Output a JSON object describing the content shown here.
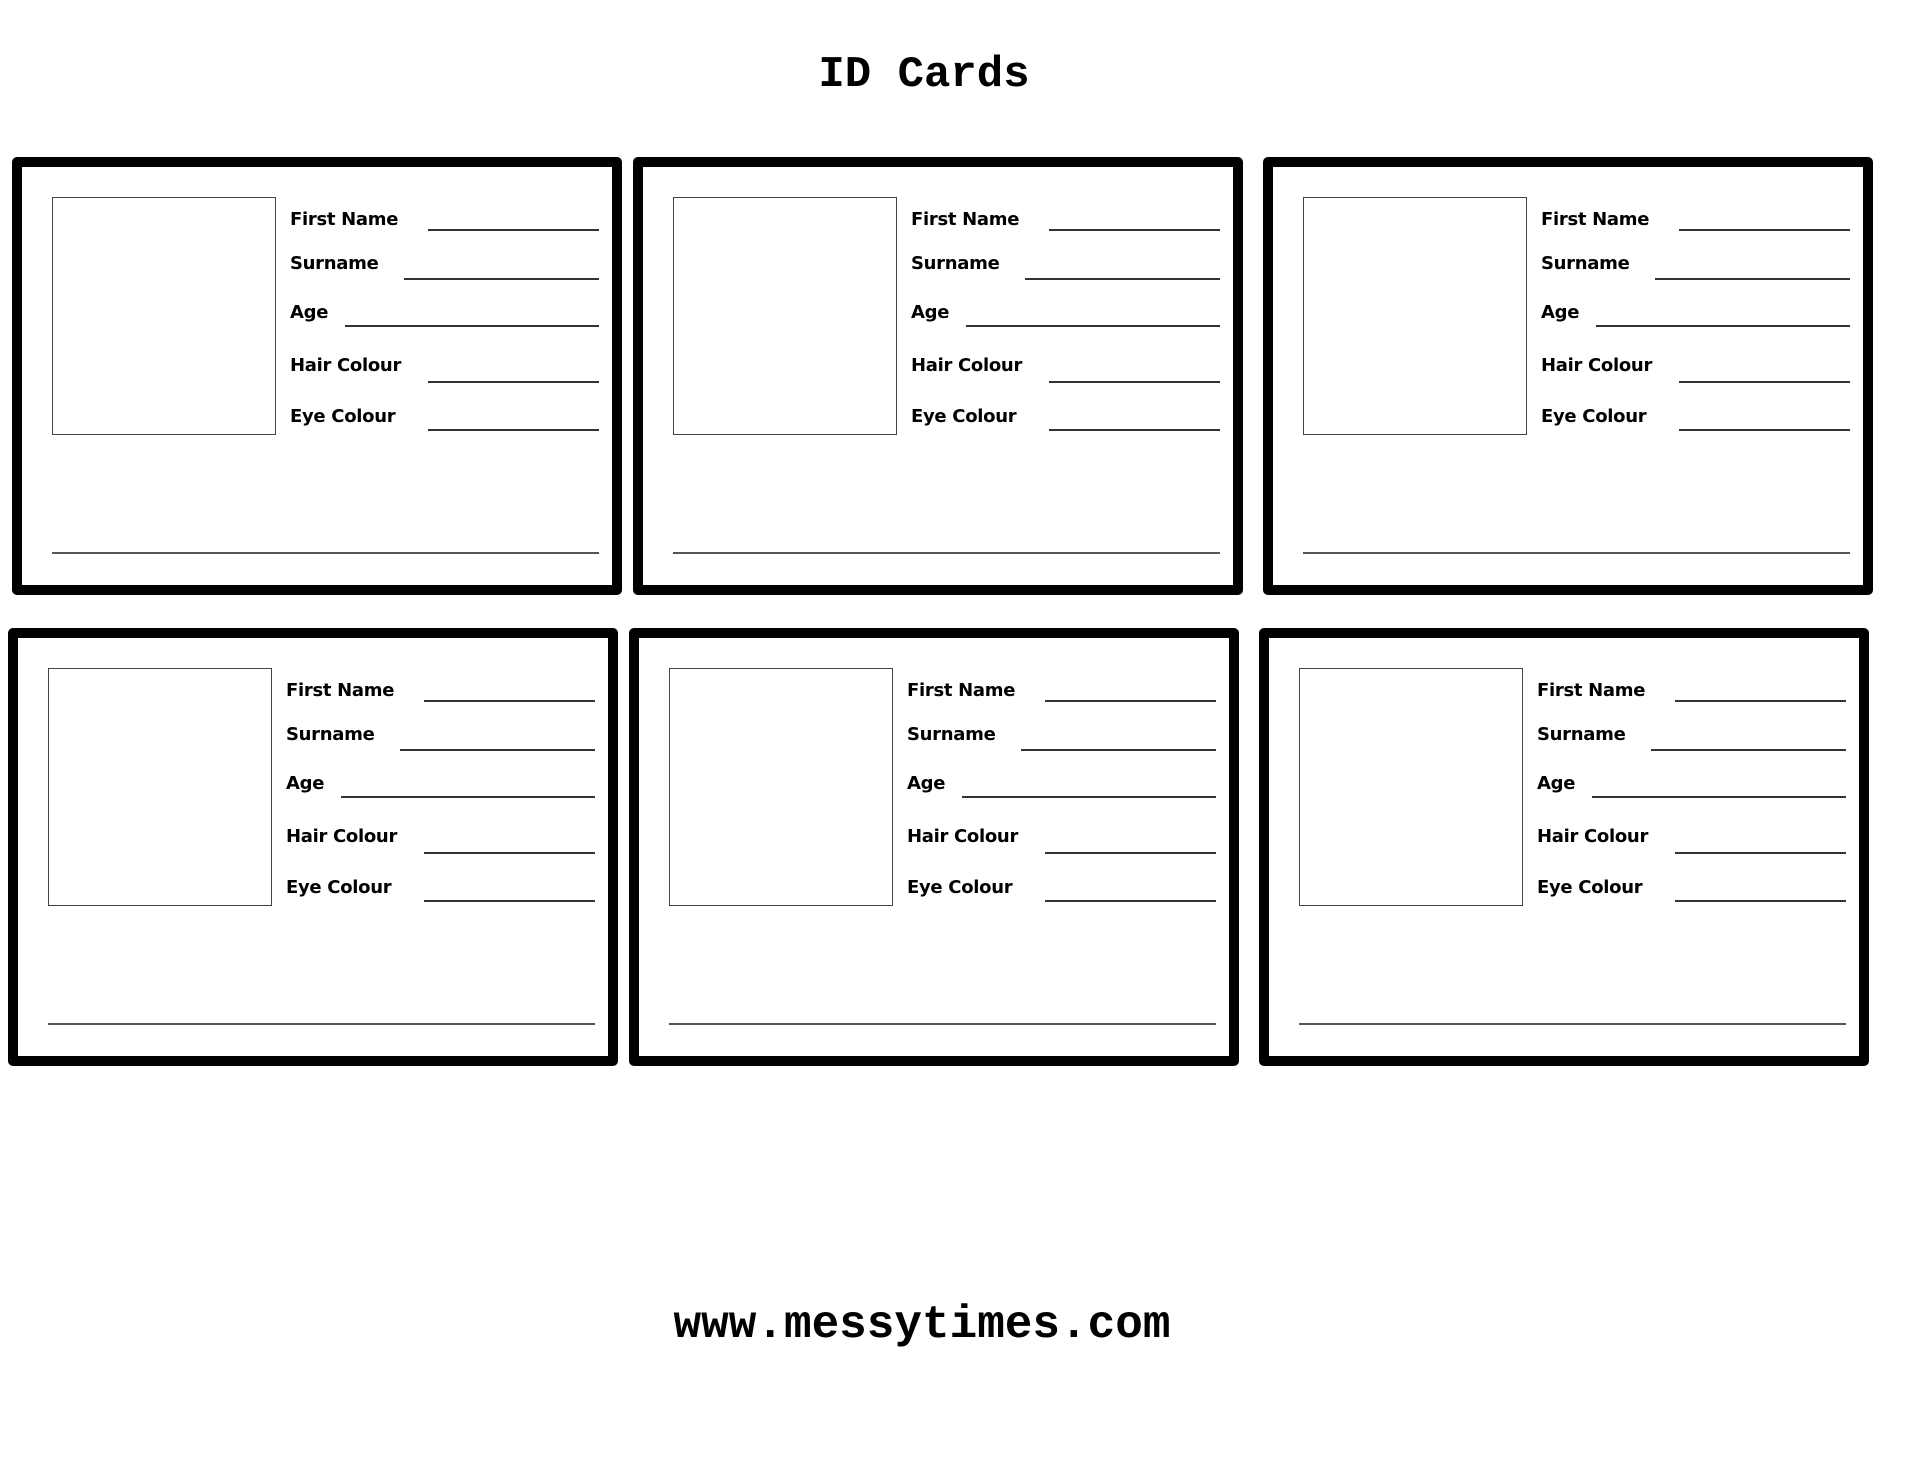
{
  "page": {
    "title": "ID Cards",
    "footer_url": "www.messytimes.com"
  },
  "card_template": {
    "photo_placeholder": "photo-box",
    "fields": [
      {
        "label": "First Name",
        "value": ""
      },
      {
        "label": "Surname",
        "value": ""
      },
      {
        "label": "Age",
        "value": ""
      },
      {
        "label": "Hair Colour",
        "value": ""
      },
      {
        "label": "Eye Colour",
        "value": ""
      }
    ],
    "signature_value": ""
  },
  "cards": [
    {
      "fields": [
        "First Name",
        "Surname",
        "Age",
        "Hair Colour",
        "Eye Colour"
      ]
    },
    {
      "fields": [
        "First Name",
        "Surname",
        "Age",
        "Hair Colour",
        "Eye Colour"
      ]
    },
    {
      "fields": [
        "First Name",
        "Surname",
        "Age",
        "Hair Colour",
        "Eye Colour"
      ]
    },
    {
      "fields": [
        "First Name",
        "Surname",
        "Age",
        "Hair Colour",
        "Eye Colour"
      ]
    },
    {
      "fields": [
        "First Name",
        "Surname",
        "Age",
        "Hair Colour",
        "Eye Colour"
      ]
    },
    {
      "fields": [
        "First Name",
        "Surname",
        "Age",
        "Hair Colour",
        "Eye Colour"
      ]
    }
  ],
  "colors": {
    "border": "#000000",
    "background": "#ffffff",
    "line": "#333333"
  }
}
